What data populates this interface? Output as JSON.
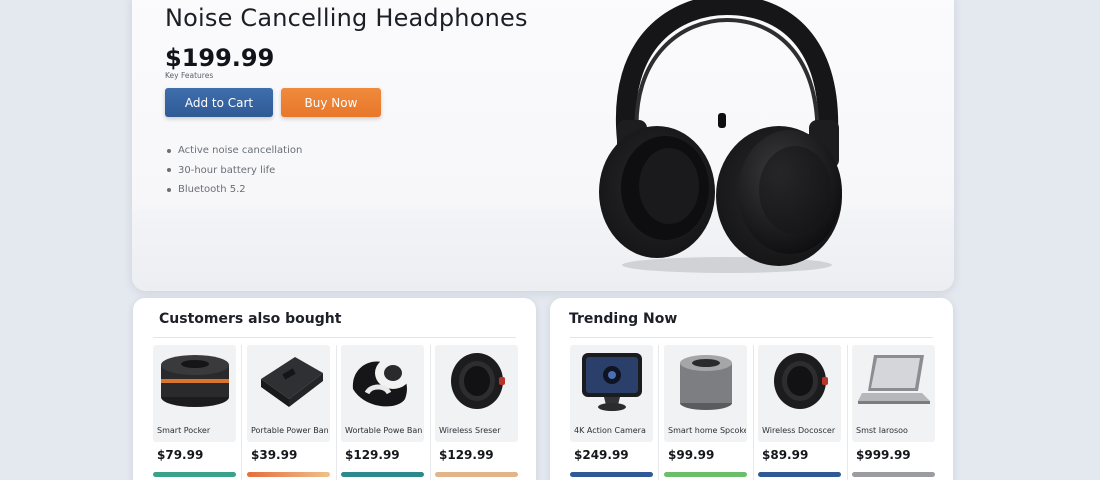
{
  "product": {
    "title": "Noise Cancelling Headphones",
    "price": "$199.99",
    "features_label": "Key Features",
    "add_to_cart_label": "Add to Cart",
    "buy_now_label": "Buy Now",
    "features": [
      "Active noise cancellation",
      "30-hour battery life",
      "Bluetooth 5.2"
    ],
    "image_icon": "headphones-icon"
  },
  "colors": {
    "primary": "#2f5a96",
    "accent": "#e8772a",
    "background": "#e4e8ef"
  },
  "customers_also_bought": {
    "title": "Customers also bought",
    "items": [
      {
        "name": "Smart Pocker",
        "price": "$79.99",
        "icon": "smart-speaker-icon",
        "bar_color": "#3aa18a"
      },
      {
        "name": "Portable Power Bank",
        "price": "$39.99",
        "icon": "power-bank-icon",
        "bar_color": "#e9874a"
      },
      {
        "name": "Wortable Powe Bank",
        "price": "$129.99",
        "icon": "wireless-earbud-icon",
        "bar_color": "#2d8a8c"
      },
      {
        "name": "Wireless Sreser",
        "price": "$129.99",
        "icon": "smartwatch-icon",
        "bar_color": "#e3b48a"
      }
    ]
  },
  "trending_now": {
    "title": "Trending Now",
    "items": [
      {
        "name": "4K Action Camera",
        "price": "$249.99",
        "icon": "camera-icon",
        "bar_color": "#2f5a96"
      },
      {
        "name": "Smart home Spcoker",
        "price": "$99.99",
        "icon": "speaker-icon",
        "bar_color": "#6cbf6a"
      },
      {
        "name": "Wireless Docoscer",
        "price": "$89.99",
        "icon": "smartwatch-icon",
        "bar_color": "#2f5a96"
      },
      {
        "name": "Smst Iarosoo",
        "price": "$999.99",
        "icon": "laptop-icon",
        "bar_color": "#9a9ca2"
      }
    ]
  }
}
